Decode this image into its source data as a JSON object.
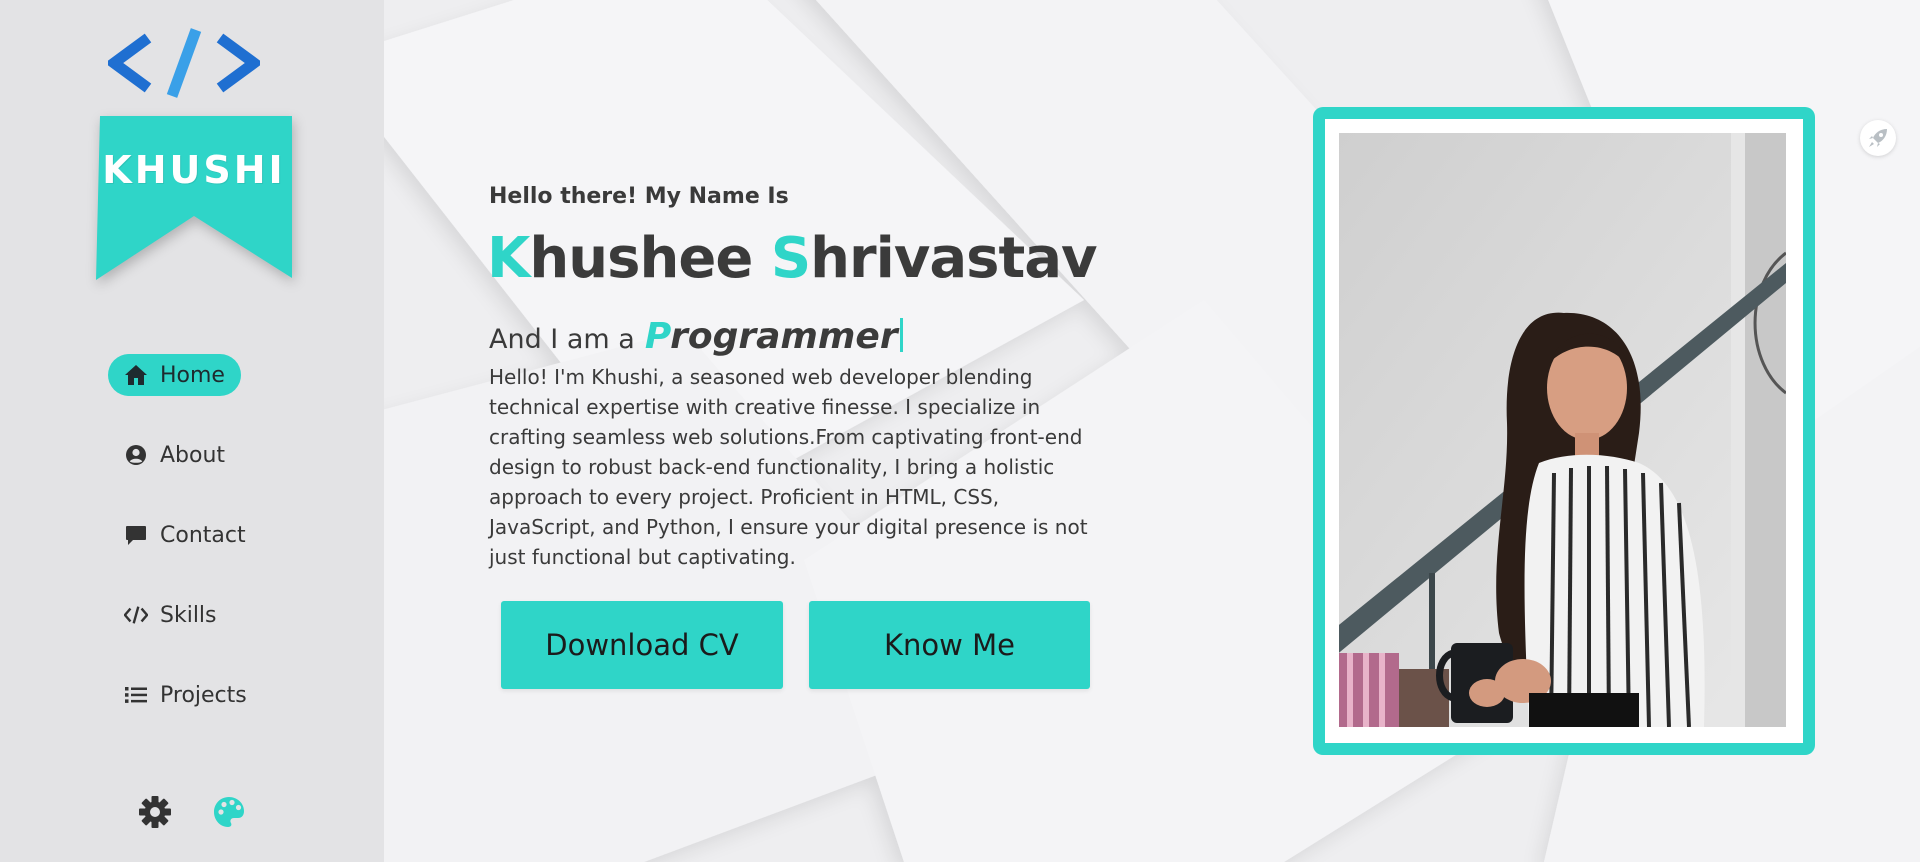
{
  "colors": {
    "accent": "#2fd5c8",
    "text": "#3b3b3b",
    "sidebar": "#e3e3e5",
    "logo_blue": "#1f6fd1"
  },
  "sidebar": {
    "logo_icon": "code-brackets-icon",
    "brand": "KHUSHI",
    "nav": [
      {
        "label": "Home",
        "icon": "home-icon",
        "active": true
      },
      {
        "label": "About",
        "icon": "user-circle-icon",
        "active": false
      },
      {
        "label": "Contact",
        "icon": "chat-bubble-icon",
        "active": false
      },
      {
        "label": "Skills",
        "icon": "code-icon",
        "active": false
      },
      {
        "label": "Projects",
        "icon": "list-icon",
        "active": false
      }
    ],
    "bottom_icons": [
      "gear-icon",
      "palette-icon"
    ]
  },
  "hero": {
    "intro": "Hello there! My Name Is",
    "name_first_initial": "K",
    "name_first_rest": "hushee",
    "name_last_initial": "S",
    "name_last_rest": "hrivastav",
    "role_prefix": "And I am a",
    "role_initial": "P",
    "role_rest": "rogrammer",
    "bio": "Hello! I'm Khushi, a seasoned web developer blending technical expertise with creative finesse. I specialize in crafting seamless web solutions.From captivating front-end design to robust back-end functionality, I bring a holistic approach to every project. Proficient in HTML, CSS, JavaScript, and Python, I ensure your digital presence is not just functional but captivating.",
    "buttons": {
      "download_cv": "Download CV",
      "know_me": "Know Me"
    }
  },
  "floating_icon": "rocket-icon"
}
